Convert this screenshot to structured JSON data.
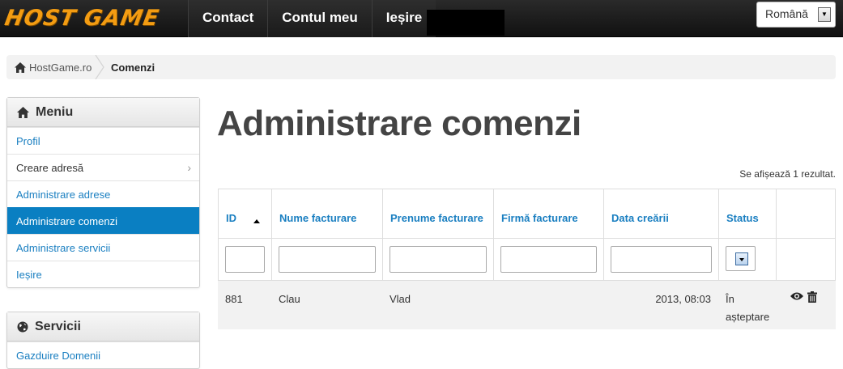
{
  "header": {
    "logo": "HOST GAME",
    "nav": [
      "Contact",
      "Contul meu",
      "Ieșire"
    ],
    "language": "Română"
  },
  "breadcrumb": {
    "home": "HostGame.ro",
    "current": "Comenzi"
  },
  "sidebar": {
    "menu": {
      "title": "Meniu",
      "items": [
        "Profil",
        "Creare adresă",
        "Administrare adrese",
        "Administrare comenzi",
        "Administrare servicii",
        "Ieșire"
      ]
    },
    "services": {
      "title": "Servicii",
      "items": [
        "Gazduire Domenii"
      ]
    }
  },
  "main": {
    "title": "Administrare comenzi",
    "summary": "Se afișează 1 rezultat.",
    "columns": [
      "ID",
      "Nume facturare",
      "Prenume facturare",
      "Firmă facturare",
      "Data creării",
      "Status"
    ],
    "rows": [
      {
        "id": "881",
        "nume": "Clau",
        "prenume": "Vlad",
        "firma": "",
        "data": "2013, 08:03",
        "status": "În așteptare"
      }
    ]
  }
}
